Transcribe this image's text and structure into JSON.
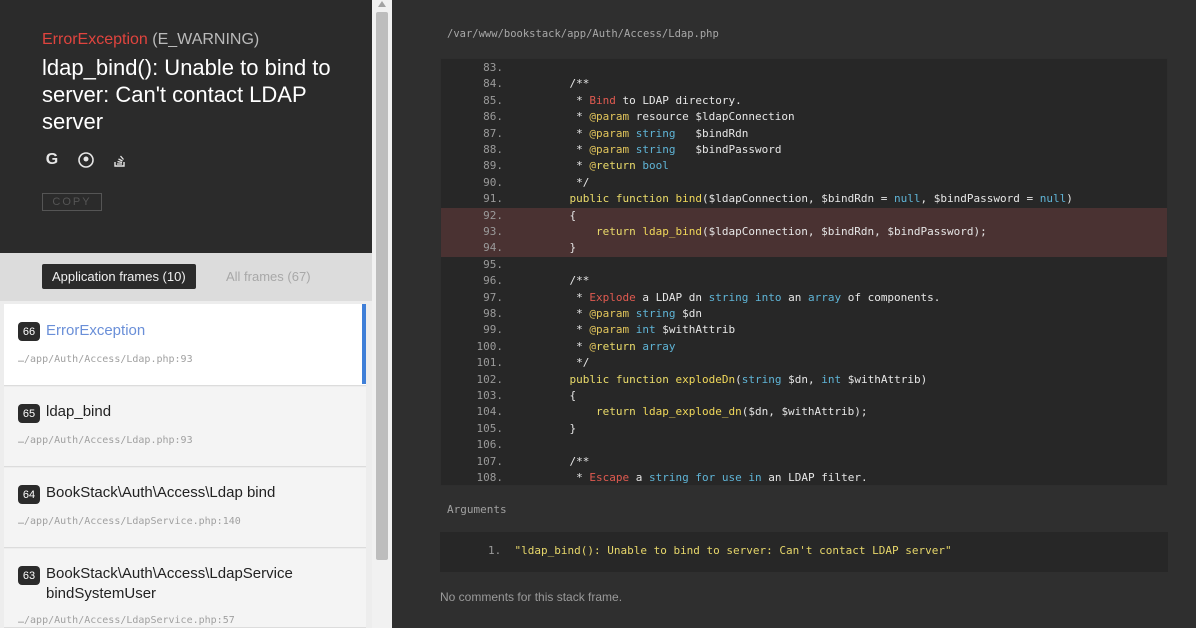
{
  "exception": {
    "class": "ErrorException",
    "type": "(E_WARNING)",
    "message": "ldap_bind(): Unable to bind to server: Can't contact LDAP server",
    "icons": [
      "google-icon",
      "duckduckgo-icon",
      "stackoverflow-icon"
    ],
    "copy_label": "COPY"
  },
  "tabs": {
    "application": "Application frames (10)",
    "all": "All frames (67)"
  },
  "frames": [
    {
      "num": "66",
      "name": "ErrorException",
      "path": "…/app/Auth/Access/Ldap.php:93"
    },
    {
      "num": "65",
      "name": "ldap_bind",
      "path": "…/app/Auth/Access/Ldap.php:93"
    },
    {
      "num": "64",
      "name": "BookStack\\Auth\\Access\\Ldap bind",
      "path": "…/app/Auth/Access/LdapService.php:140"
    },
    {
      "num": "63",
      "name": "BookStack\\Auth\\Access\\LdapService bindSystemUser",
      "path": "…/app/Auth/Access/LdapService.php:57"
    }
  ],
  "code": {
    "file": "/var/www/bookstack/app/Auth/Access/Ldap.php",
    "highlight_line": 93,
    "lines": [
      {
        "n": "83.",
        "t": ""
      },
      {
        "n": "84.",
        "t": "    /**"
      },
      {
        "n": "85.",
        "t": "     * Bind to LDAP directory."
      },
      {
        "n": "86.",
        "t": "     * @param resource $ldapConnection"
      },
      {
        "n": "87.",
        "t": "     * @param string   $bindRdn"
      },
      {
        "n": "88.",
        "t": "     * @param string   $bindPassword"
      },
      {
        "n": "89.",
        "t": "     * @return bool"
      },
      {
        "n": "90.",
        "t": "     */"
      },
      {
        "n": "91.",
        "t": "    public function bind($ldapConnection, $bindRdn = null, $bindPassword = null)"
      },
      {
        "n": "92.",
        "t": "    {"
      },
      {
        "n": "93.",
        "t": "        return ldap_bind($ldapConnection, $bindRdn, $bindPassword);"
      },
      {
        "n": "94.",
        "t": "    }"
      },
      {
        "n": "95.",
        "t": ""
      },
      {
        "n": "96.",
        "t": "    /**"
      },
      {
        "n": "97.",
        "t": "     * Explode a LDAP dn string into an array of components."
      },
      {
        "n": "98.",
        "t": "     * @param string $dn"
      },
      {
        "n": "99.",
        "t": "     * @param int $withAttrib"
      },
      {
        "n": "100.",
        "t": "     * @return array"
      },
      {
        "n": "101.",
        "t": "     */"
      },
      {
        "n": "102.",
        "t": "    public function explodeDn(string $dn, int $withAttrib)"
      },
      {
        "n": "103.",
        "t": "    {"
      },
      {
        "n": "104.",
        "t": "        return ldap_explode_dn($dn, $withAttrib);"
      },
      {
        "n": "105.",
        "t": "    }"
      },
      {
        "n": "106.",
        "t": ""
      },
      {
        "n": "107.",
        "t": "    /**"
      },
      {
        "n": "108.",
        "t": "     * Escape a string for use in an LDAP filter."
      }
    ]
  },
  "arguments": {
    "label": "Arguments",
    "items": [
      {
        "num": "1.",
        "value": "\"ldap_bind(): Unable to bind to server: Can't contact LDAP server\""
      }
    ]
  },
  "comments_text": "No comments for this stack frame."
}
